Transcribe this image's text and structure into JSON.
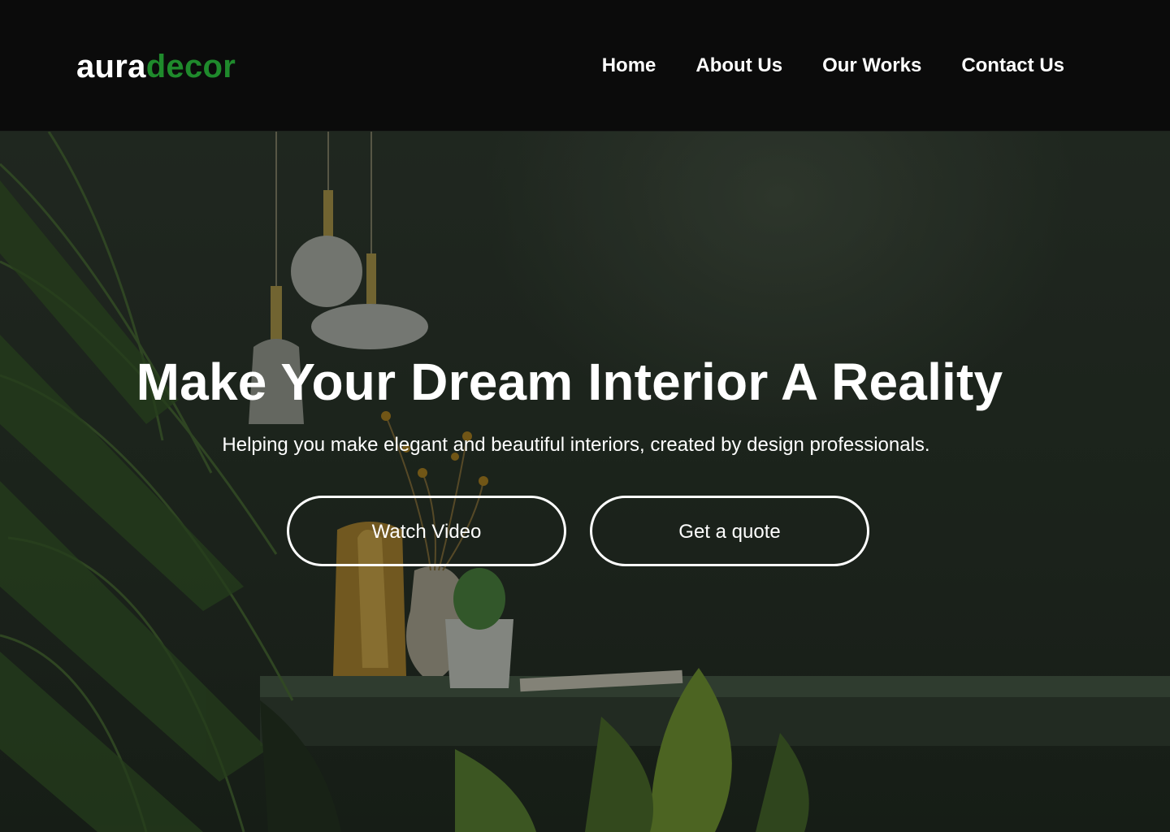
{
  "brand": {
    "logo_part1": "aura",
    "logo_part2": "decor",
    "primary_color": "#1f8a2c"
  },
  "nav": {
    "items": [
      {
        "label": "Home"
      },
      {
        "label": "About Us"
      },
      {
        "label": "Our Works"
      },
      {
        "label": "Contact Us"
      }
    ]
  },
  "hero": {
    "title": "Make Your Dream Interior A Reality",
    "subtitle": "Helping you make elegant and beautiful interiors, created by design professionals.",
    "buttons": {
      "watch_video": "Watch Video",
      "get_quote": "Get a quote"
    }
  }
}
